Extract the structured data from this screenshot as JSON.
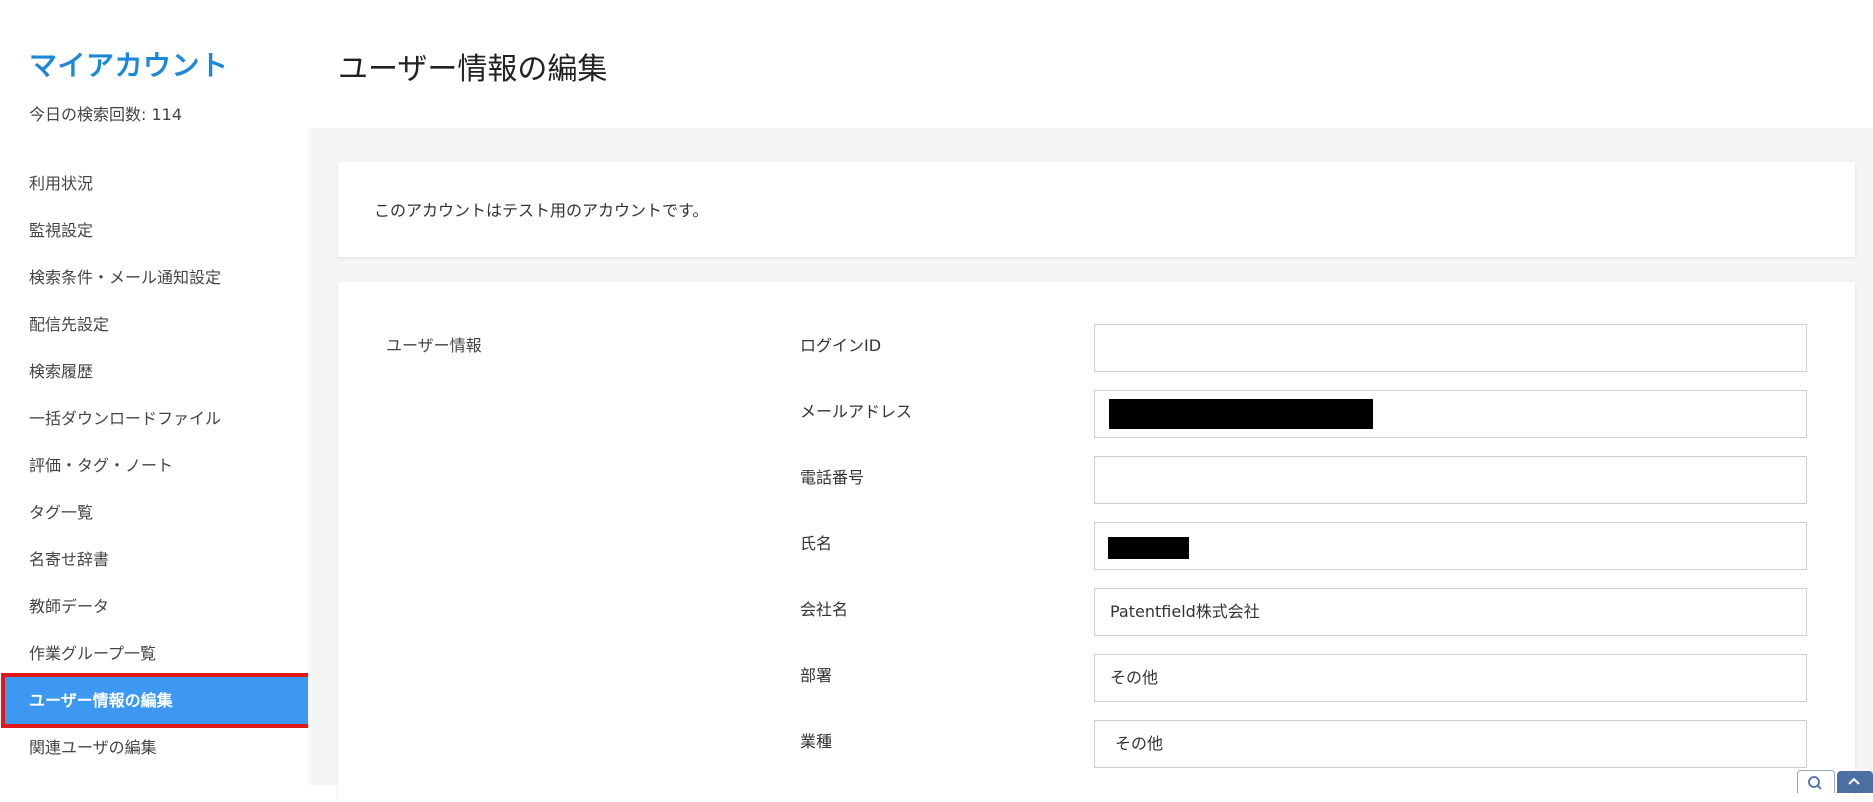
{
  "sidebar": {
    "title": "マイアカウント",
    "search_count": "今日の検索回数: 114",
    "items": [
      {
        "label": "利用状況"
      },
      {
        "label": "監視設定"
      },
      {
        "label": "検索条件・メール通知設定"
      },
      {
        "label": "配信先設定"
      },
      {
        "label": "検索履歴"
      },
      {
        "label": "一括ダウンロードファイル"
      },
      {
        "label": "評価・タグ・ノート"
      },
      {
        "label": "タグ一覧"
      },
      {
        "label": "名寄せ辞書"
      },
      {
        "label": "教師データ"
      },
      {
        "label": "作業グループ一覧"
      },
      {
        "label": "ユーザー情報の編集"
      },
      {
        "label": "関連ユーザの編集"
      }
    ],
    "active_index": 11
  },
  "header": {
    "title": "ユーザー情報の編集"
  },
  "notice": {
    "text": "このアカウントはテスト用のアカウントです。"
  },
  "form": {
    "section_label": "ユーザー情報",
    "fields": [
      {
        "label": "ログインID",
        "value": ""
      },
      {
        "label": "メールアドレス",
        "value": ""
      },
      {
        "label": "電話番号",
        "value": ""
      },
      {
        "label": "氏名",
        "value": ""
      },
      {
        "label": "会社名",
        "value": "Patentfield株式会社"
      },
      {
        "label": "部署",
        "value": "その他"
      },
      {
        "label": "業種",
        "value": "その他"
      }
    ]
  },
  "colors": {
    "brand": "#1e88d8",
    "active_bg": "#3c98f0",
    "highlight_border": "#e01818"
  },
  "icons": {
    "float_search": "search-icon",
    "float_top": "chevron-up-icon"
  }
}
